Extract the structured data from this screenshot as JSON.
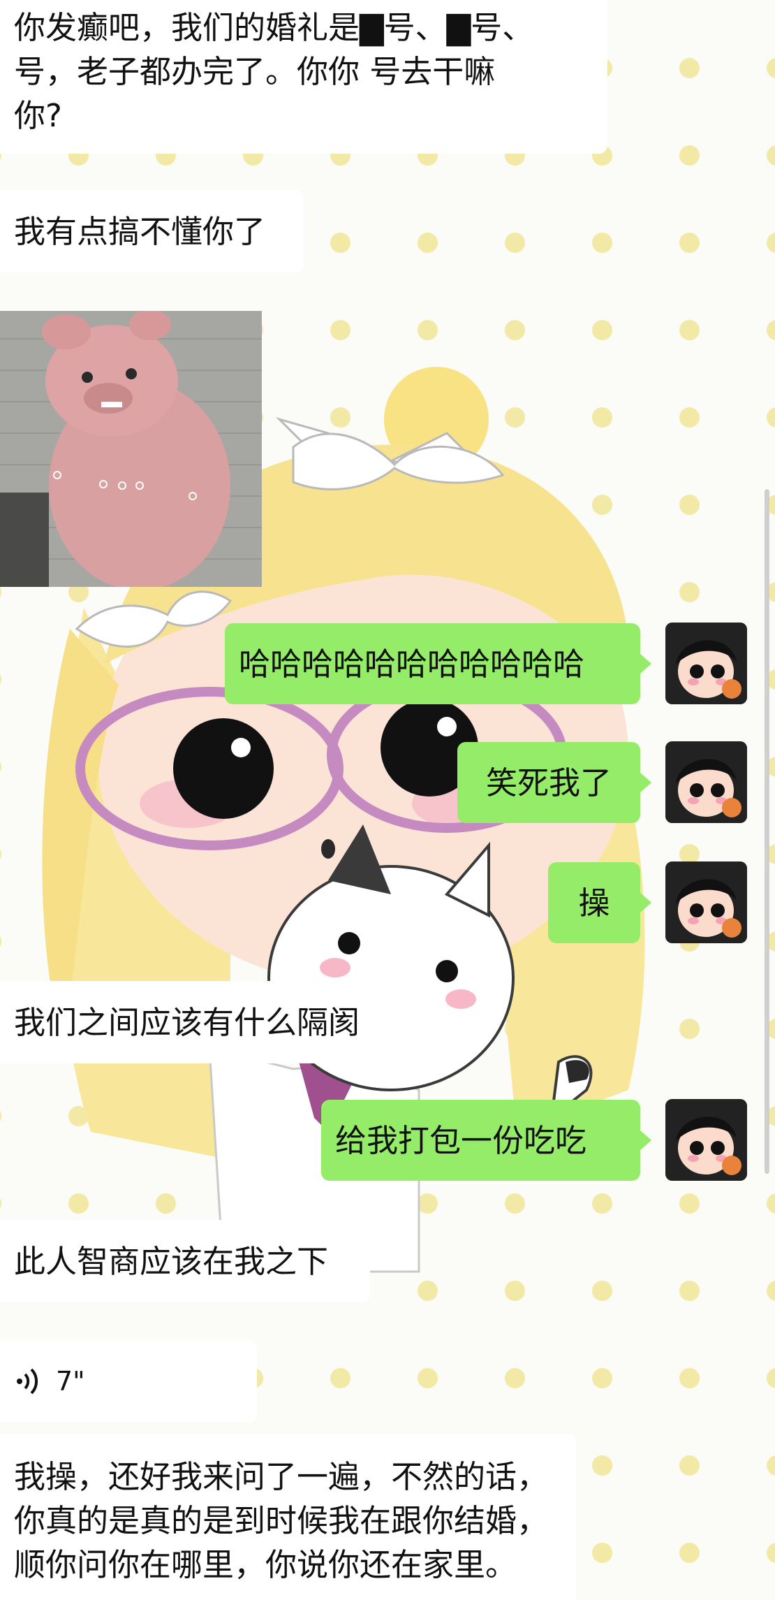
{
  "colors": {
    "sent_bubble": "#95ec69",
    "received_bubble": "#ffffff",
    "background": "#fbfbf7",
    "dots": "#f3e9a6"
  },
  "messages": [
    {
      "side": "left",
      "type": "text",
      "text": "你发癫吧，我们的婚礼是▇号、▇号、\n号，老子都办完了。你你  号去干嘛\n你?"
    },
    {
      "side": "left",
      "type": "text",
      "text": "我有点搞不懂你了"
    },
    {
      "side": "left",
      "type": "image",
      "description_icon": "pig-statue-image"
    },
    {
      "side": "right",
      "type": "text",
      "text": "哈哈哈哈哈哈哈哈哈哈哈"
    },
    {
      "side": "right",
      "type": "text",
      "text": "笑死我了"
    },
    {
      "side": "right",
      "type": "text",
      "text": "操"
    },
    {
      "side": "left",
      "type": "text",
      "text": "我们之间应该有什么隔阂"
    },
    {
      "side": "right",
      "type": "text",
      "text": "给我打包一份吃吃"
    },
    {
      "side": "left",
      "type": "text",
      "text": "此人智商应该在我之下"
    },
    {
      "side": "left",
      "type": "voice",
      "duration": "7\""
    },
    {
      "side": "left",
      "type": "text",
      "text": "我操，还好我来问了一遍，不然的话，\n你真的是真的是到时候我在跟你结婚，\n顺你问你在哪里，你说你还在家里。"
    }
  ]
}
